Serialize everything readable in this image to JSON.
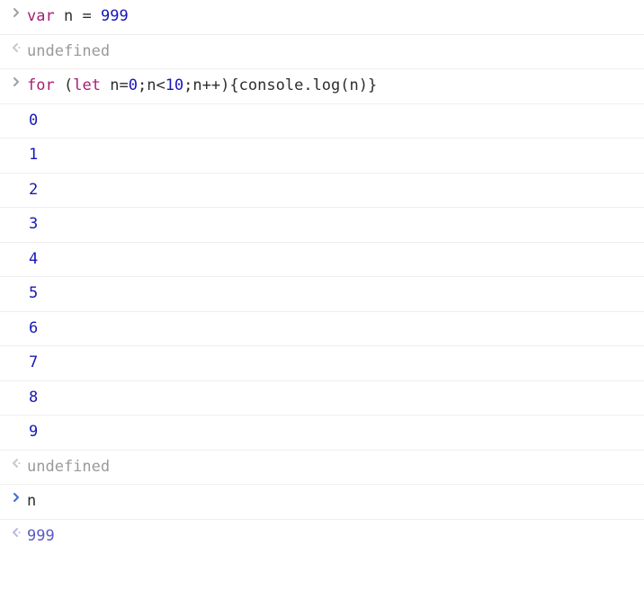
{
  "rows": [
    {
      "type": "input",
      "code": [
        {
          "cls": "tok-keyword",
          "t": "var"
        },
        {
          "cls": "",
          "t": " "
        },
        {
          "cls": "tok-ident",
          "t": "n"
        },
        {
          "cls": "",
          "t": " "
        },
        {
          "cls": "tok-op",
          "t": "="
        },
        {
          "cls": "",
          "t": " "
        },
        {
          "cls": "tok-num",
          "t": "999"
        }
      ]
    },
    {
      "type": "result-undefined",
      "text": "undefined"
    },
    {
      "type": "input",
      "code": [
        {
          "cls": "tok-keyword",
          "t": "for"
        },
        {
          "cls": "",
          "t": " "
        },
        {
          "cls": "tok-punc",
          "t": "("
        },
        {
          "cls": "tok-keyword",
          "t": "let"
        },
        {
          "cls": "",
          "t": " "
        },
        {
          "cls": "tok-ident",
          "t": "n"
        },
        {
          "cls": "tok-op",
          "t": "="
        },
        {
          "cls": "tok-num",
          "t": "0"
        },
        {
          "cls": "tok-punc",
          "t": ";"
        },
        {
          "cls": "tok-ident",
          "t": "n"
        },
        {
          "cls": "tok-op",
          "t": "<"
        },
        {
          "cls": "tok-num",
          "t": "10"
        },
        {
          "cls": "tok-punc",
          "t": ";"
        },
        {
          "cls": "tok-ident",
          "t": "n"
        },
        {
          "cls": "tok-op",
          "t": "++"
        },
        {
          "cls": "tok-punc",
          "t": ")"
        },
        {
          "cls": "tok-punc",
          "t": "{"
        },
        {
          "cls": "tok-ident",
          "t": "console"
        },
        {
          "cls": "tok-punc",
          "t": "."
        },
        {
          "cls": "tok-ident",
          "t": "log"
        },
        {
          "cls": "tok-punc",
          "t": "("
        },
        {
          "cls": "tok-ident",
          "t": "n"
        },
        {
          "cls": "tok-punc",
          "t": ")"
        },
        {
          "cls": "tok-punc",
          "t": "}"
        }
      ]
    },
    {
      "type": "log",
      "text": "0"
    },
    {
      "type": "log",
      "text": "1"
    },
    {
      "type": "log",
      "text": "2"
    },
    {
      "type": "log",
      "text": "3"
    },
    {
      "type": "log",
      "text": "4"
    },
    {
      "type": "log",
      "text": "5"
    },
    {
      "type": "log",
      "text": "6"
    },
    {
      "type": "log",
      "text": "7"
    },
    {
      "type": "log",
      "text": "8"
    },
    {
      "type": "log",
      "text": "9"
    },
    {
      "type": "result-undefined",
      "text": "undefined"
    },
    {
      "type": "input-bold",
      "code": [
        {
          "cls": "tok-ident",
          "t": "n"
        }
      ]
    },
    {
      "type": "result-value",
      "text": "999"
    }
  ]
}
